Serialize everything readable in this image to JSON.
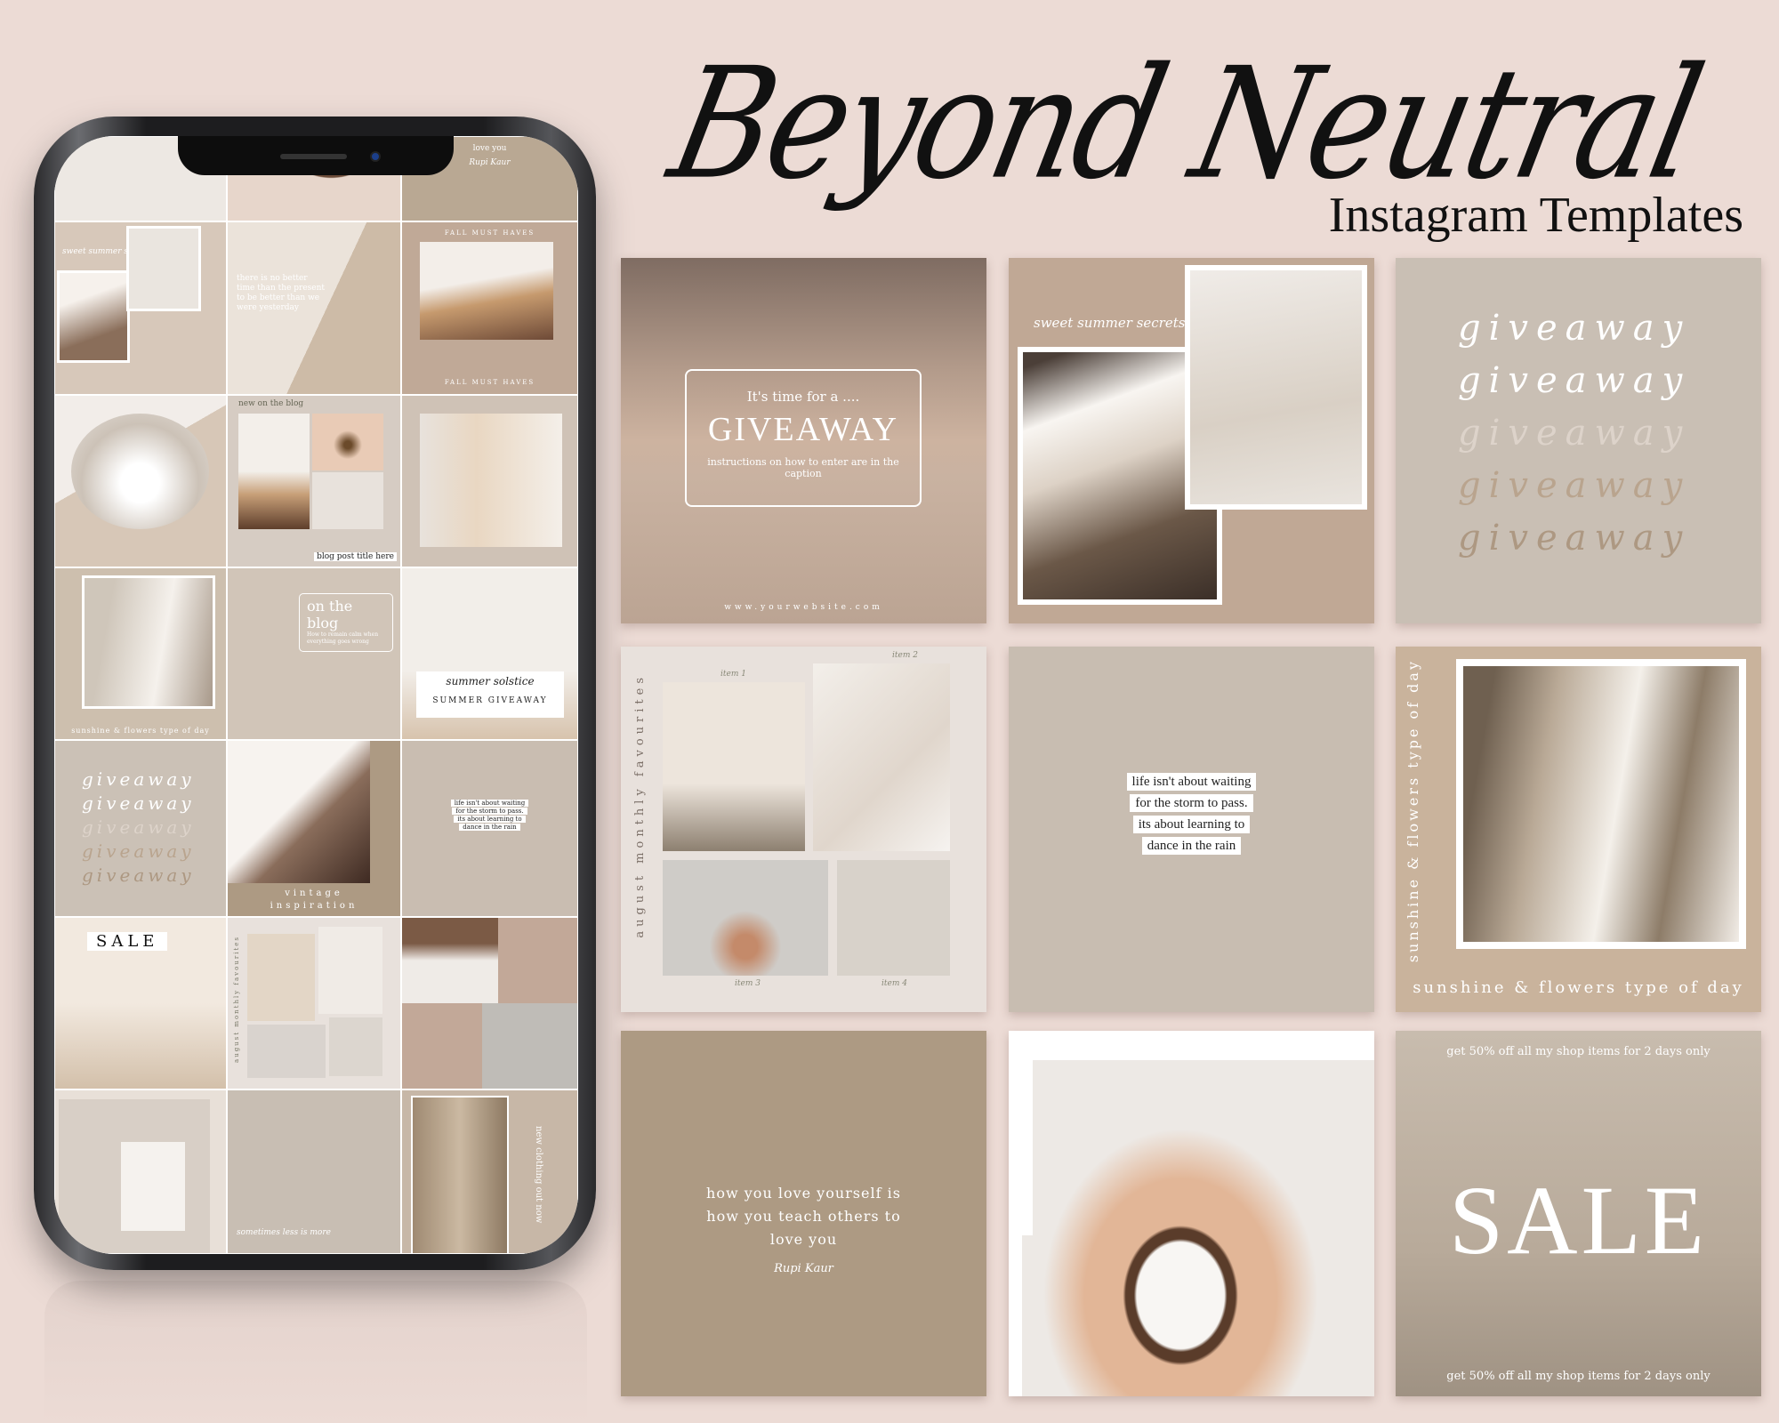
{
  "header": {
    "title": "Beyond Neutral",
    "subtitle": "Instagram Templates"
  },
  "templates": {
    "giveaway_sky": {
      "intro": "It's time for a ....",
      "headline": "GIVEAWAY",
      "instructions": "instructions on how to enter are in the caption",
      "website": "www.yourwebsite.com"
    },
    "summer_secrets": {
      "script": "sweet summer secrets"
    },
    "giveaway_repeat": {
      "words": [
        "giveaway",
        "giveaway",
        "giveaway",
        "giveaway",
        "giveaway"
      ],
      "colors": [
        "#ffffff",
        "#ffffff",
        "#ddd3ca",
        "#b9a48e",
        "#ad9882"
      ]
    },
    "favourites": {
      "vertical": "august monthly favourites",
      "items": [
        "item 1",
        "item 2",
        "item 3",
        "item 4"
      ]
    },
    "quote_rain": {
      "lines": [
        "life isn't about waiting",
        "for the storm to pass.",
        "its about learning to",
        "dance in the rain"
      ]
    },
    "sunshine": {
      "vertical": "sunshine & flowers type of day",
      "caption": "sunshine & flowers type of day"
    },
    "love_quote": {
      "lines": [
        "how you love yourself is",
        "how you teach others to",
        "love you"
      ],
      "signature": "Rupi Kaur"
    },
    "sale": {
      "top": "get 50% off all my shop items for 2 days only",
      "headline": "SALE",
      "bottom": "get 50% off all my shop items for 2 days only"
    }
  },
  "phone": {
    "love_you": "love you",
    "signature": "Rupi Kaur",
    "summer_script": "sweet summer secrets",
    "better_time": "there is no better time than the present to be better than we were yesterday",
    "fall": "FALL MUST HAVES",
    "new_blog": "new on the blog",
    "blog_post": "blog post title here",
    "sunshine": "sunshine & flowers type of day",
    "on_blog": "on the blog",
    "on_blog_sub": "How to remain calm when everything goes wrong",
    "solstice": "summer solstice",
    "summer_giveaway": "SUMMER GIVEAWAY",
    "giveaway_words": [
      "giveaway",
      "giveaway",
      "giveaway",
      "giveaway",
      "giveaway"
    ],
    "vintage": "vintage",
    "inspiration": "inspiration",
    "rain_lines": [
      "life isn't about waiting",
      "for the storm to pass.",
      "its about learning to",
      "dance in the rain"
    ],
    "sale": "SALE",
    "favourites": "august monthly favourites",
    "less": "sometimes less is more",
    "clothing": "new clothing out now"
  },
  "colors": {
    "background": "#ecdbd5",
    "accent": "#ad9a83"
  }
}
